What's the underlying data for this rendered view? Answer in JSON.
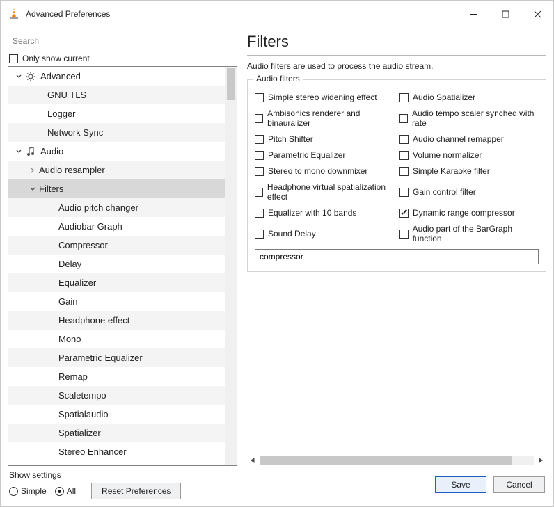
{
  "titlebar": {
    "title": "Advanced Preferences"
  },
  "search": {
    "placeholder": "Search"
  },
  "only_current": {
    "label": "Only show current"
  },
  "tree": {
    "advanced": {
      "label": "Advanced",
      "gnu_tls": "GNU TLS",
      "logger": "Logger",
      "network_sync": "Network Sync"
    },
    "audio": {
      "label": "Audio",
      "resampler": "Audio resampler",
      "filters": {
        "label": "Filters",
        "items": [
          "Audio pitch changer",
          "Audiobar Graph",
          "Compressor",
          "Delay",
          "Equalizer",
          "Gain",
          "Headphone effect",
          "Mono",
          "Parametric Equalizer",
          "Remap",
          "Scaletempo",
          "Spatialaudio",
          "Spatializer",
          "Stereo Enhancer"
        ]
      }
    }
  },
  "page": {
    "title": "Filters",
    "desc": "Audio filters are used to process the audio stream."
  },
  "group": {
    "legend": "Audio filters",
    "left": [
      "Simple stereo widening effect",
      "Ambisonics renderer and binauralizer",
      "Pitch Shifter",
      "Parametric Equalizer",
      "Stereo to mono downmixer",
      "Headphone virtual spatialization effect",
      "Equalizer with 10 bands",
      "Sound Delay"
    ],
    "right": [
      "Audio Spatializer",
      "Audio tempo scaler synched with rate",
      "Audio channel remapper",
      "Volume normalizer",
      "Simple Karaoke filter",
      "Gain control filter",
      "Dynamic range compressor",
      "Audio part of the BarGraph function"
    ],
    "checked_right_index": 6,
    "text_value": "compressor"
  },
  "footer": {
    "show_settings": "Show settings",
    "simple": "Simple",
    "all": "All",
    "reset": "Reset Preferences",
    "save": "Save",
    "cancel": "Cancel"
  }
}
